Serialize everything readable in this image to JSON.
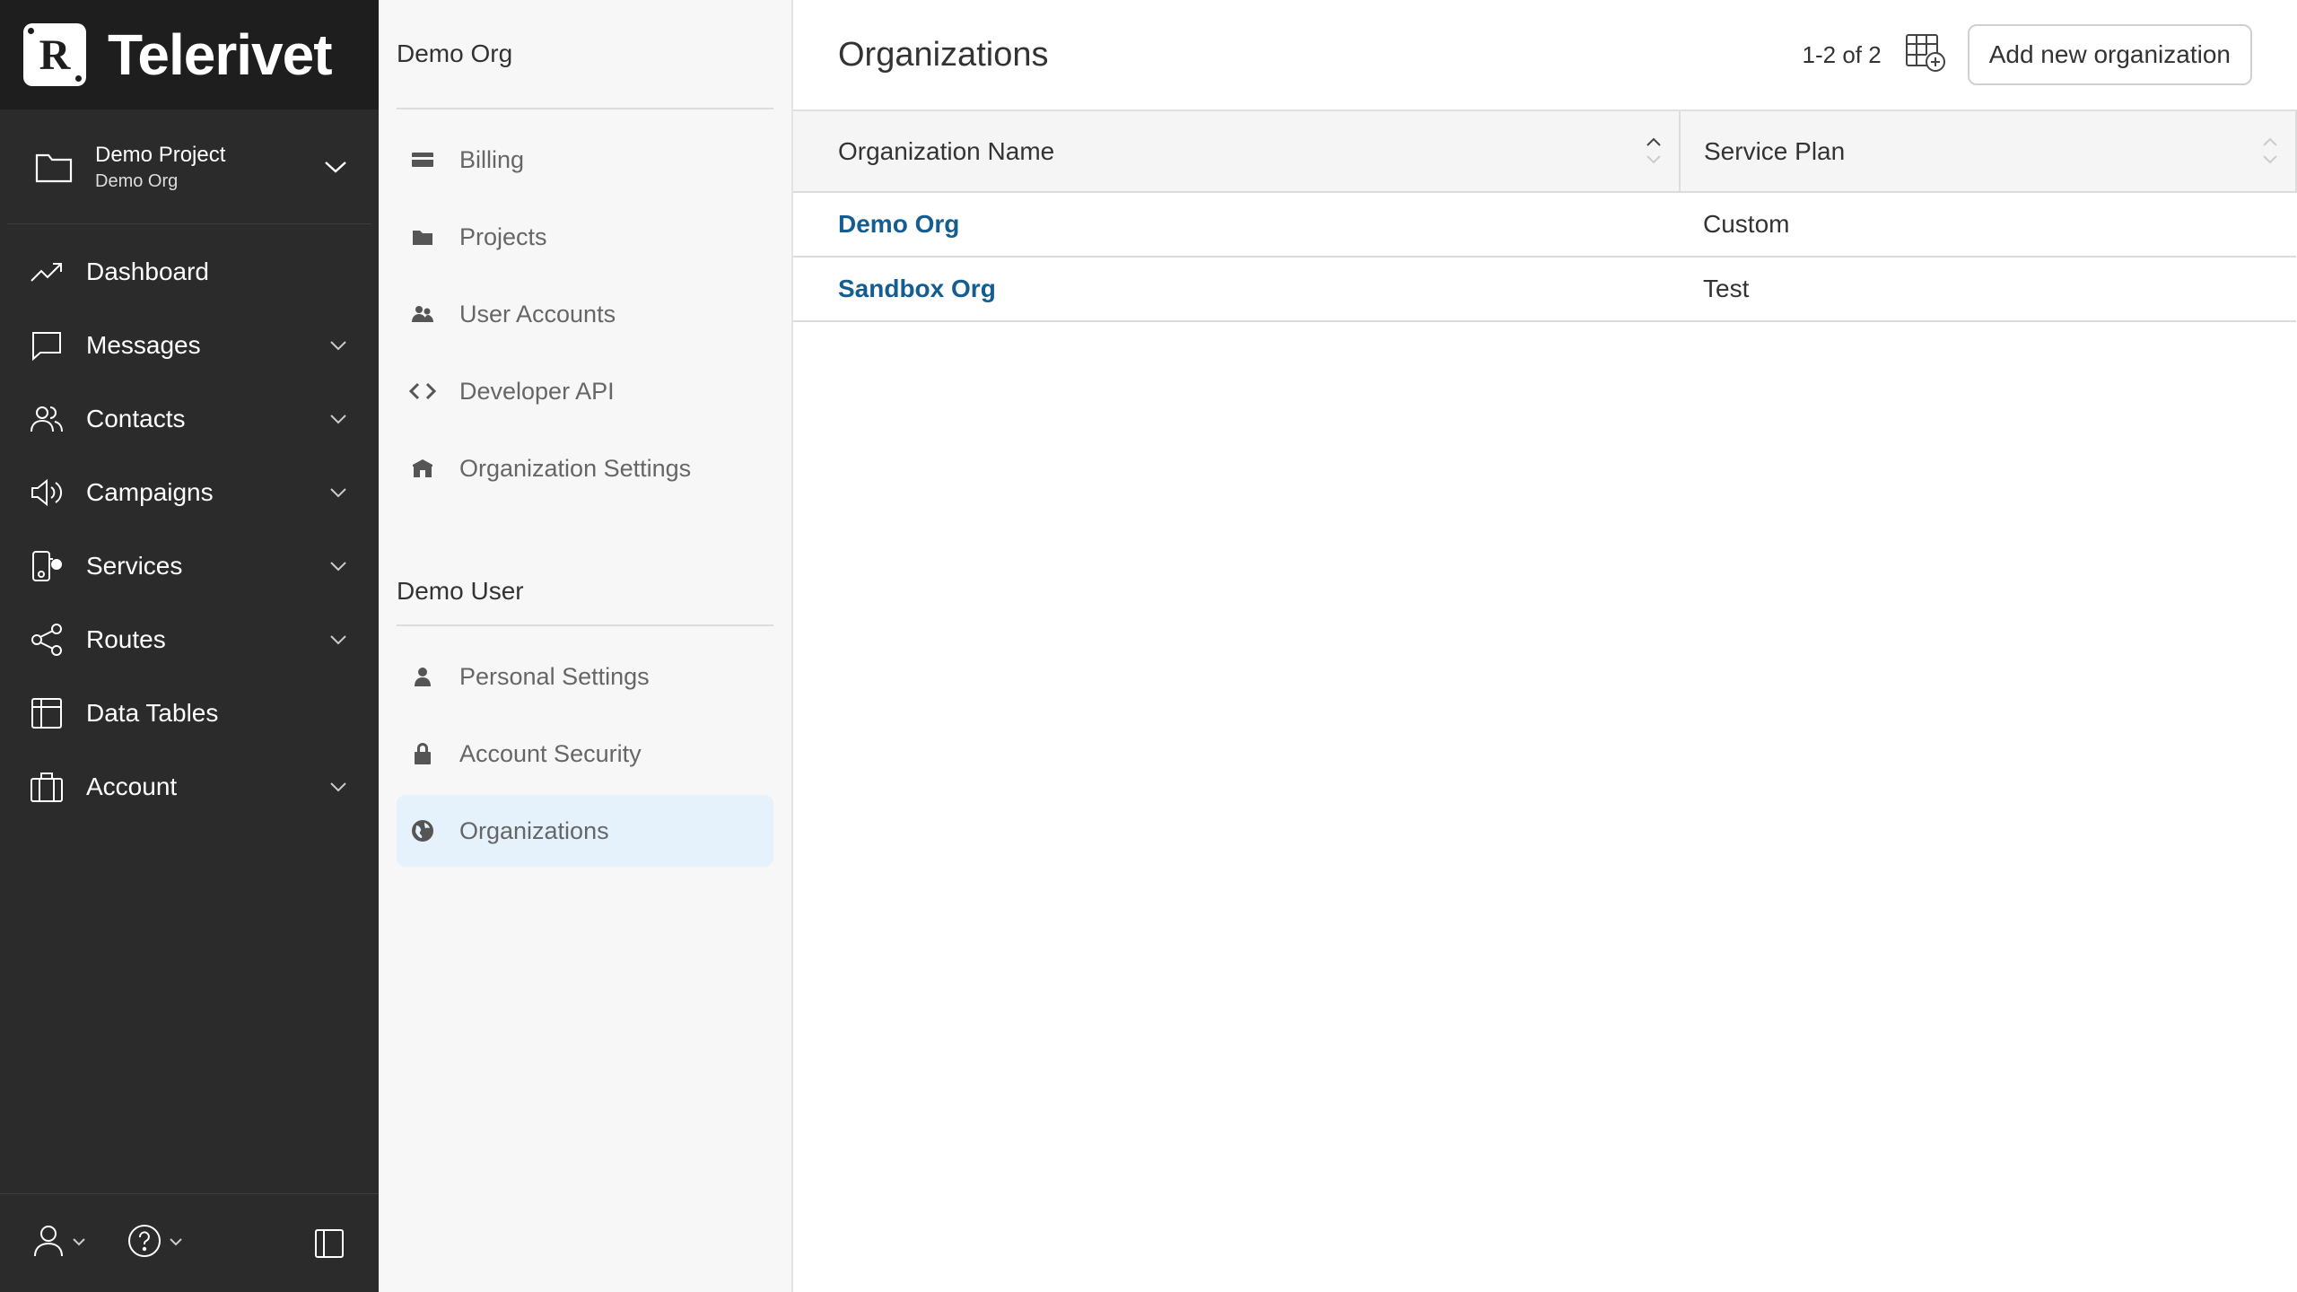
{
  "brand": {
    "logo_letter": "R",
    "name": "Telerivet"
  },
  "project": {
    "name": "Demo Project",
    "org": "Demo Org"
  },
  "nav": [
    {
      "label": "Dashboard",
      "icon": "trend-icon",
      "has_chevron": false
    },
    {
      "label": "Messages",
      "icon": "chat-icon",
      "has_chevron": true
    },
    {
      "label": "Contacts",
      "icon": "people-icon",
      "has_chevron": true
    },
    {
      "label": "Campaigns",
      "icon": "megaphone-icon",
      "has_chevron": true
    },
    {
      "label": "Services",
      "icon": "services-icon",
      "has_chevron": true
    },
    {
      "label": "Routes",
      "icon": "share-icon",
      "has_chevron": true
    },
    {
      "label": "Data Tables",
      "icon": "table-icon",
      "has_chevron": false
    },
    {
      "label": "Account",
      "icon": "briefcase-icon",
      "has_chevron": true
    }
  ],
  "settings": {
    "org_section_title": "Demo Org",
    "org_items": [
      {
        "label": "Billing",
        "icon": "credit-card-icon"
      },
      {
        "label": "Projects",
        "icon": "folder-icon"
      },
      {
        "label": "User Accounts",
        "icon": "users-icon"
      },
      {
        "label": "Developer API",
        "icon": "code-icon"
      },
      {
        "label": "Organization Settings",
        "icon": "building-icon"
      }
    ],
    "user_section_title": "Demo User",
    "user_items": [
      {
        "label": "Personal Settings",
        "icon": "person-icon"
      },
      {
        "label": "Account Security",
        "icon": "lock-icon"
      },
      {
        "label": "Organizations",
        "icon": "globe-icon",
        "active": true
      }
    ]
  },
  "main": {
    "title": "Organizations",
    "pager": "1-2 of 2",
    "add_button": "Add new organization",
    "columns": {
      "name": "Organization Name",
      "plan": "Service Plan"
    },
    "rows": [
      {
        "name": "Demo Org",
        "plan": "Custom"
      },
      {
        "name": "Sandbox Org",
        "plan": "Test"
      }
    ]
  },
  "colors": {
    "sidebar_bg": "#2b2b2b",
    "brand_bg": "#1e1e1e",
    "link": "#135d91",
    "active_item_bg": "#e6f2fb"
  }
}
